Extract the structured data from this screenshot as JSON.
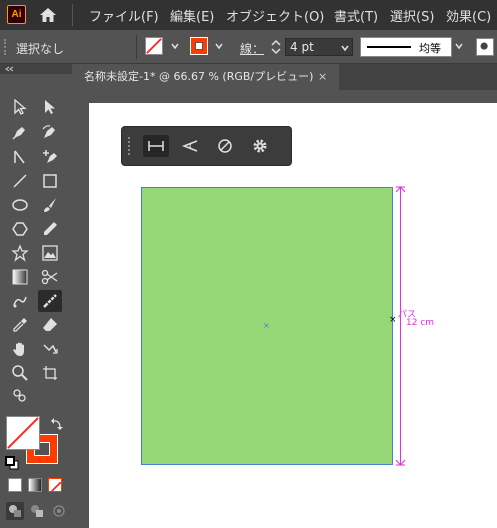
{
  "app": {
    "logo_text": "Ai"
  },
  "menu": {
    "items": [
      "ファイル(F)",
      "編集(E)",
      "オブジェクト(O)",
      "書式(T)",
      "選択(S)",
      "効果(C)"
    ]
  },
  "control_bar": {
    "selection_status": "選択なし",
    "stroke_label": "線：",
    "stroke_weight": "4 pt",
    "profile_label": "均等"
  },
  "document_tab": {
    "title": "名称未設定-1* @ 66.67 % (RGB/プレビュー)",
    "close": "×"
  },
  "canvas": {
    "shape_fill": "#96d878",
    "shape_border": "#4a7fd8",
    "dimension_color": "#e030e0",
    "center_mark": "×",
    "anchor_mark": "×",
    "path_label": "パス",
    "measure_value": "12 cm"
  },
  "icons": {
    "home": "home-icon",
    "fill_swatch": "none-fill-icon",
    "stroke_swatch": "red-stroke-icon"
  },
  "colors": {
    "accent_red": "#ff3c00",
    "menubar_bg": "#323232",
    "panel_bg": "#535353"
  }
}
